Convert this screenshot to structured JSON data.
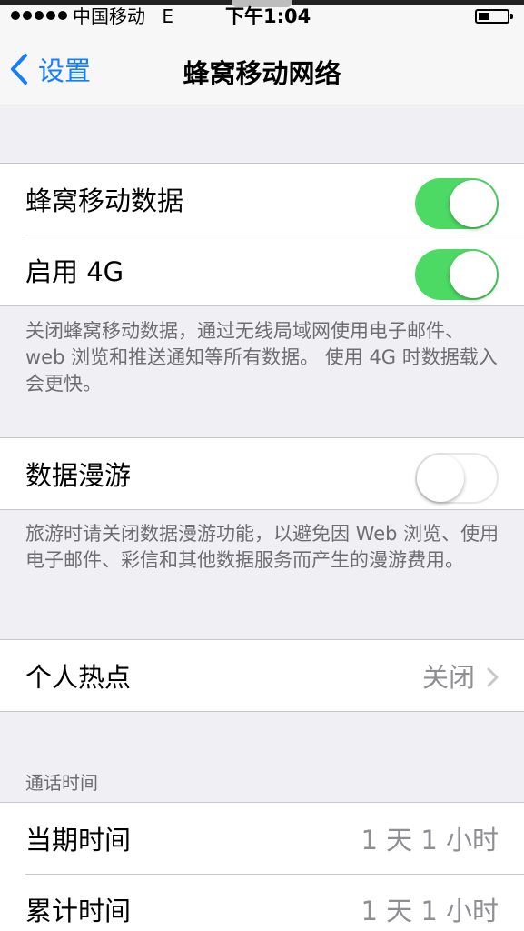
{
  "status_bar": {
    "carrier": "中国移动",
    "network": "E",
    "time": "下午1:04"
  },
  "nav": {
    "back_label": "设置",
    "title": "蜂窝移动网络"
  },
  "settings": {
    "cellular_data": {
      "label": "蜂窝移动数据",
      "enabled": true
    },
    "enable_4g": {
      "label": "启用 4G",
      "enabled": true
    },
    "cellular_footnote": "关闭蜂窝移动数据，通过无线局域网使用电子邮件、web 浏览和推送通知等所有数据。 使用 4G 时数据载入会更快。",
    "data_roaming": {
      "label": "数据漫游",
      "enabled": false
    },
    "roaming_footnote": "旅游时请关闭数据漫游功能，以避免因 Web 浏览、使用电子邮件、彩信和其他数据服务而产生的漫游费用。",
    "hotspot": {
      "label": "个人热点",
      "value": "关闭"
    }
  },
  "call_time": {
    "header": "通话时间",
    "current_period": {
      "label": "当期时间",
      "value": "1 天 1 小时"
    },
    "lifetime": {
      "label": "累计时间",
      "value": "1 天 1 小时"
    }
  },
  "colors": {
    "accent": "#147efb",
    "switch_on": "#4cd964",
    "background": "#efeff4"
  }
}
